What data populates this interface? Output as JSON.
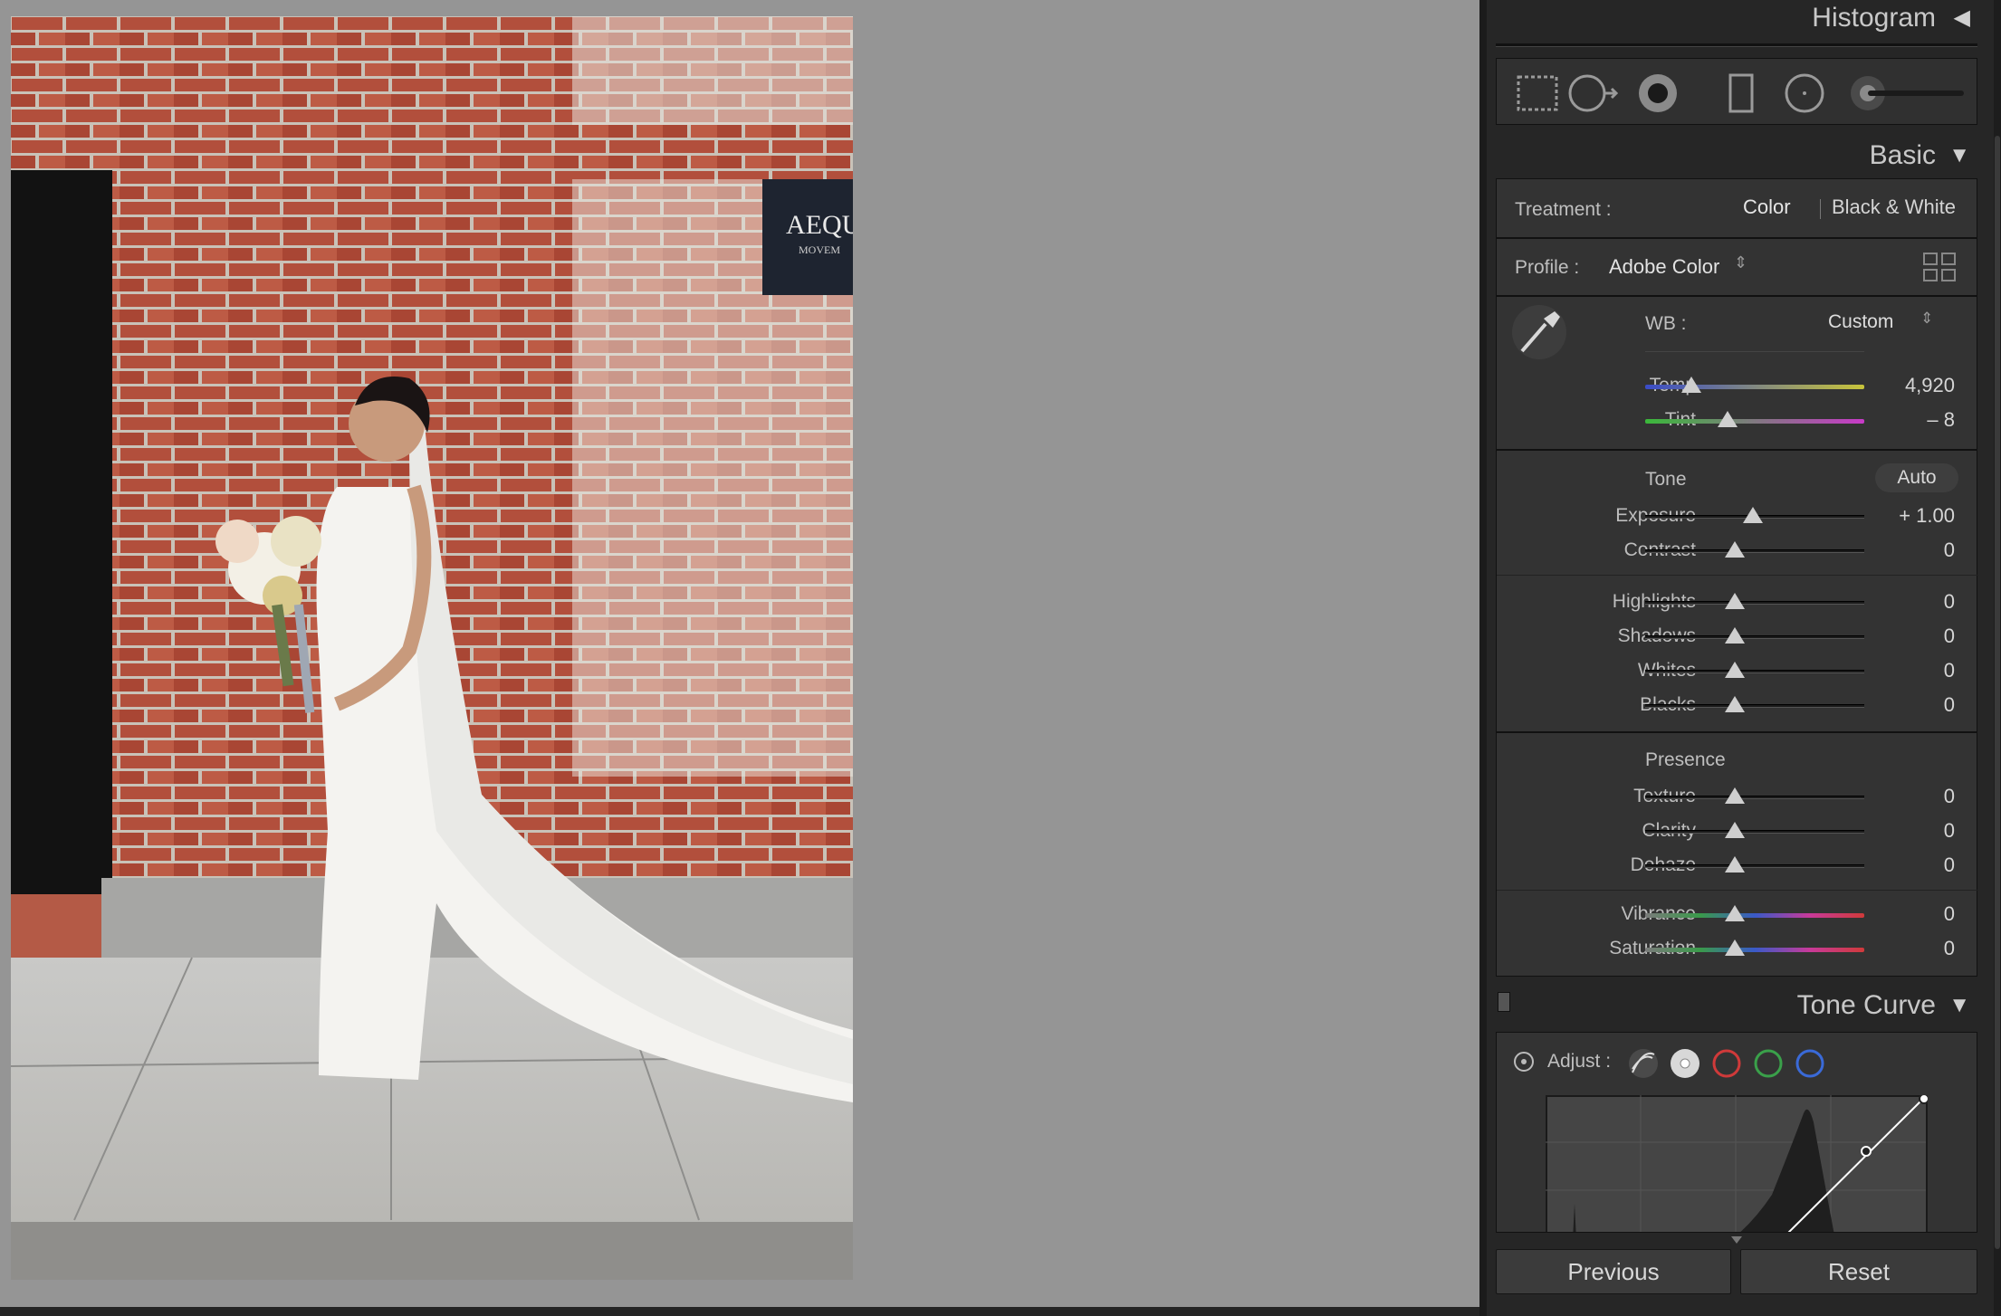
{
  "histogram": {
    "title": "Histogram"
  },
  "tools": [
    "crop-overlay-icon",
    "spot-removal-icon",
    "red-eye-icon",
    "graduated-filter-icon",
    "radial-filter-icon",
    "adjustment-brush-icon"
  ],
  "basic": {
    "title": "Basic",
    "treatment_label": "Treatment :",
    "treatment_color": "Color",
    "treatment_bw": "Black & White",
    "profile_label": "Profile :",
    "profile_value": "Adobe Color",
    "wb_label": "WB :",
    "wb_value": "Custom",
    "temp_label": "Temp",
    "temp_value": "4,920",
    "tint_label": "Tint",
    "tint_value": "– 8",
    "tone_label": "Tone",
    "auto_label": "Auto",
    "exposure_label": "Exposure",
    "exposure_value": "+ 1.00",
    "contrast_label": "Contrast",
    "contrast_value": "0",
    "highlights_label": "Highlights",
    "highlights_value": "0",
    "shadows_label": "Shadows",
    "shadows_value": "0",
    "whites_label": "Whites",
    "whites_value": "0",
    "blacks_label": "Blacks",
    "blacks_value": "0",
    "presence_label": "Presence",
    "texture_label": "Texture",
    "texture_value": "0",
    "clarity_label": "Clarity",
    "clarity_value": "0",
    "dehaze_label": "Dehaze",
    "dehaze_value": "0",
    "vibrance_label": "Vibrance",
    "vibrance_value": "0",
    "saturation_label": "Saturation",
    "saturation_value": "0"
  },
  "tone_curve": {
    "title": "Tone Curve",
    "adjust_label": "Adjust :"
  },
  "photo": {
    "sign_text": "AEQU",
    "sign_sub": "MOVEM"
  },
  "footer": {
    "previous_label": "Previous",
    "reset_label": "Reset"
  },
  "colors": {
    "panel_bg": "#262626",
    "section_bg": "#333333",
    "accent_red": "#d03a3a",
    "accent_green": "#3aa04a",
    "accent_blue": "#3a6ad8"
  }
}
